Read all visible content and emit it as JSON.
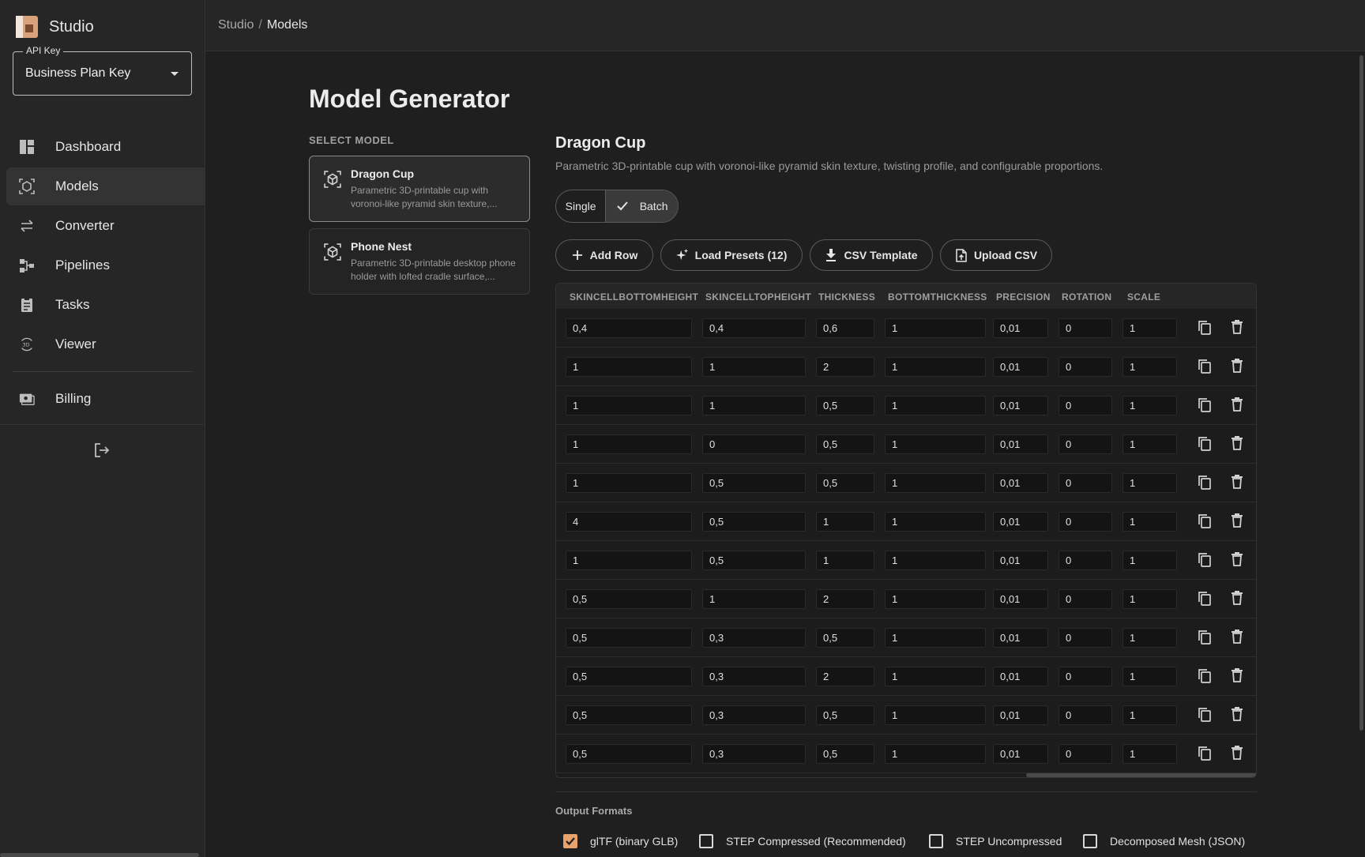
{
  "app": {
    "title": "Studio"
  },
  "api_key": {
    "legend": "API Key",
    "value": "Business Plan Key"
  },
  "nav": [
    {
      "label": "Dashboard",
      "icon": "dashboard-icon"
    },
    {
      "label": "Models",
      "icon": "models-icon",
      "active": true
    },
    {
      "label": "Converter",
      "icon": "converter-icon"
    },
    {
      "label": "Pipelines",
      "icon": "pipelines-icon"
    },
    {
      "label": "Tasks",
      "icon": "tasks-icon"
    },
    {
      "label": "Viewer",
      "icon": "viewer-3d-icon"
    },
    {
      "label": "Billing",
      "icon": "billing-icon"
    }
  ],
  "breadcrumb": {
    "root": "Studio",
    "sep": "/",
    "current": "Models"
  },
  "page": {
    "title": "Model Generator",
    "select_label": "SELECT MODEL"
  },
  "models": [
    {
      "name": "Dragon Cup",
      "desc": "Parametric 3D-printable cup with voronoi-like pyramid skin texture,...",
      "active": true
    },
    {
      "name": "Phone Nest",
      "desc": "Parametric 3D-printable desktop phone holder with lofted cradle surface,..."
    }
  ],
  "detail": {
    "title": "Dragon Cup",
    "desc": "Parametric 3D-printable cup with voronoi-like pyramid skin texture, twisting profile, and configurable proportions."
  },
  "mode": {
    "single": "Single",
    "batch": "Batch",
    "selected": "Batch"
  },
  "actions": {
    "add_row": "Add Row",
    "load_presets": "Load Presets (12)",
    "csv_template": "CSV Template",
    "upload_csv": "Upload CSV"
  },
  "table": {
    "headers": [
      "SKINCELLBOTTOMHEIGHT",
      "SKINCELLTOPHEIGHT",
      "THICKNESS",
      "BOTTOMTHICKNESS",
      "PRECISION",
      "ROTATION",
      "SCALE"
    ],
    "rows": [
      [
        "0,4",
        "0,4",
        "0,6",
        "1",
        "0,01",
        "0",
        "1"
      ],
      [
        "1",
        "1",
        "2",
        "1",
        "0,01",
        "0",
        "1"
      ],
      [
        "1",
        "1",
        "0,5",
        "1",
        "0,01",
        "0",
        "1"
      ],
      [
        "1",
        "0",
        "0,5",
        "1",
        "0,01",
        "0",
        "1"
      ],
      [
        "1",
        "0,5",
        "0,5",
        "1",
        "0,01",
        "0",
        "1"
      ],
      [
        "4",
        "0,5",
        "1",
        "1",
        "0,01",
        "0",
        "1"
      ],
      [
        "1",
        "0,5",
        "1",
        "1",
        "0,01",
        "0",
        "1"
      ],
      [
        "0,5",
        "1",
        "2",
        "1",
        "0,01",
        "0",
        "1"
      ],
      [
        "0,5",
        "0,3",
        "0,5",
        "1",
        "0,01",
        "0",
        "1"
      ],
      [
        "0,5",
        "0,3",
        "2",
        "1",
        "0,01",
        "0",
        "1"
      ],
      [
        "0,5",
        "0,3",
        "0,5",
        "1",
        "0,01",
        "0",
        "1"
      ],
      [
        "0,5",
        "0,3",
        "0,5",
        "1",
        "0,01",
        "0",
        "1"
      ]
    ]
  },
  "output": {
    "label": "Output Formats",
    "formats": [
      {
        "label": "glTF (binary GLB)",
        "checked": true
      },
      {
        "label": "STEP Compressed (Recommended)",
        "checked": false
      },
      {
        "label": "STEP Uncompressed",
        "checked": false
      },
      {
        "label": "Decomposed Mesh (JSON)",
        "checked": false
      }
    ]
  },
  "colors": {
    "accent": "#e8a36c",
    "background": "#1f1f1f",
    "sidebar": "#262626"
  }
}
